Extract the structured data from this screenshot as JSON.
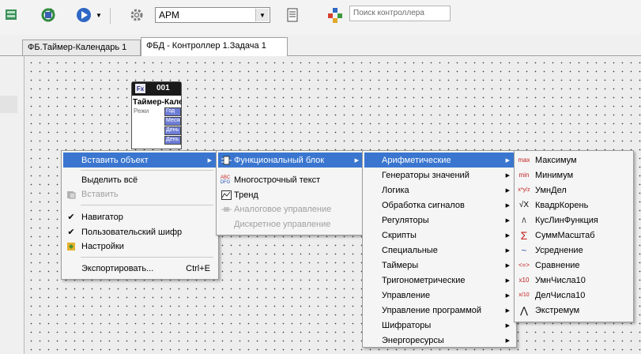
{
  "toolbar": {
    "combo_value": "АРМ",
    "search_placeholder": "Поиск контроллера",
    "icons": [
      "database-icon",
      "refresh-icon",
      "play-icon",
      "gear-icon",
      "document-icon",
      "network-icon"
    ]
  },
  "tabs": [
    {
      "label": "ФБ.Таймер-Календарь 1",
      "active": false
    },
    {
      "label": "ФБД - Контроллер 1.Задача 1",
      "active": true
    }
  ],
  "block": {
    "icon_text": "Fx",
    "number": "001",
    "title": "Таймер-Календарь",
    "input_label": "Режи",
    "pins": [
      "Год",
      "Месяц",
      "День",
      "День"
    ]
  },
  "context_menu": {
    "insert_object": "Вставить объект",
    "select_all": "Выделить всё",
    "paste": "Вставить",
    "navigator": "Навигатор",
    "user_cipher": "Пользовательский шифр",
    "settings": "Настройки",
    "export": "Экспортировать...",
    "export_shortcut": "Ctrl+E"
  },
  "insert_menu": {
    "function_block": "Функциональный блок",
    "multiline_text": "Многострочный текст",
    "trend": "Тренд",
    "analog_control": "Аналоговое управление",
    "discrete_control": "Дискретное управление"
  },
  "categories_menu": [
    "Арифметические",
    "Генераторы значений",
    "Логика",
    "Обработка сигналов",
    "Регуляторы",
    "Скрипты",
    "Специальные",
    "Таймеры",
    "Тригонометрические",
    "Управление",
    "Управление программой",
    "Шифраторы",
    "Энергоресурсы"
  ],
  "arithmetic_menu": [
    {
      "icon": "max",
      "label": "Максимум"
    },
    {
      "icon": "min",
      "label": "Минимум"
    },
    {
      "icon": "x*y/z",
      "label": "УмнДел"
    },
    {
      "icon": "√X",
      "label": "КвадрКорень"
    },
    {
      "icon": "/\\",
      "label": "КусЛинФункция"
    },
    {
      "icon": "Σ",
      "label": "СуммМасштаб"
    },
    {
      "icon": "~",
      "label": "Усреднение"
    },
    {
      "icon": "<=>",
      "label": "Сравнение"
    },
    {
      "icon": "x10",
      "label": "УмнЧисла10"
    },
    {
      "icon": "x/10",
      "label": "ДелЧисла10"
    },
    {
      "icon": "⋀",
      "label": "Экстремум"
    }
  ],
  "colors": {
    "highlight": "#3a76cf",
    "pin": "#6d7dd6",
    "header": "#1a1a1a"
  }
}
